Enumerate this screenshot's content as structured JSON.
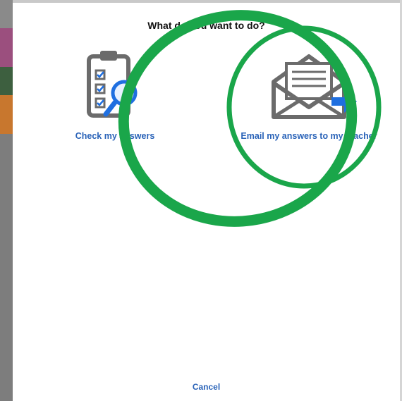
{
  "dialog": {
    "title": "What do you want to do?",
    "cancel_label": "Cancel",
    "options": [
      {
        "label": "Check my answers",
        "icon": "clipboard-magnifier-icon"
      },
      {
        "label": "Email my answers to my teacher",
        "icon": "envelope-letter-icon"
      }
    ]
  },
  "colors": {
    "link": "#2a63b8",
    "annotation": "#1aa64a",
    "icon_gray": "#6b6b6b",
    "accent_blue": "#1f6fe0"
  }
}
